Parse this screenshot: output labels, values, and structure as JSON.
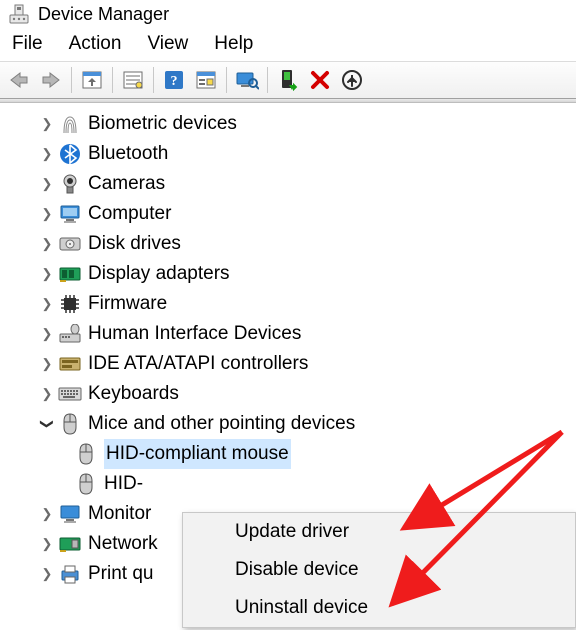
{
  "window": {
    "title": "Device Manager"
  },
  "menu": {
    "file": "File",
    "action": "Action",
    "view": "View",
    "help": "Help"
  },
  "toolbar": {
    "back": "back",
    "forward": "forward",
    "show_hidden": "show-hidden",
    "properties_list": "properties-list",
    "help": "help",
    "action_props": "action-properties",
    "scan": "scan-hardware",
    "enable": "enable-device",
    "remove": "remove-device",
    "update": "update-driver"
  },
  "tree": {
    "items": [
      {
        "label": "Biometric devices",
        "icon": "fingerprint"
      },
      {
        "label": "Bluetooth",
        "icon": "bluetooth"
      },
      {
        "label": "Cameras",
        "icon": "camera"
      },
      {
        "label": "Computer",
        "icon": "computer"
      },
      {
        "label": "Disk drives",
        "icon": "disk"
      },
      {
        "label": "Display adapters",
        "icon": "display-adapter"
      },
      {
        "label": "Firmware",
        "icon": "firmware"
      },
      {
        "label": "Human Interface Devices",
        "icon": "hid"
      },
      {
        "label": "IDE ATA/ATAPI controllers",
        "icon": "ide"
      },
      {
        "label": "Keyboards",
        "icon": "keyboard"
      },
      {
        "label": "Mice and other pointing devices",
        "icon": "mouse",
        "expanded": true,
        "children": [
          {
            "label": "HID-compliant mouse",
            "icon": "mouse",
            "selected": true
          },
          {
            "label": "HID-",
            "icon": "mouse"
          }
        ]
      },
      {
        "label": "Monitor",
        "icon": "monitor",
        "truncated": true
      },
      {
        "label": "Network",
        "icon": "network",
        "truncated": true
      },
      {
        "label": "Print qu",
        "icon": "printer",
        "truncated": true
      }
    ]
  },
  "context_menu": {
    "items": [
      {
        "label": "Update driver"
      },
      {
        "label": "Disable device"
      },
      {
        "label": "Uninstall device"
      }
    ]
  }
}
